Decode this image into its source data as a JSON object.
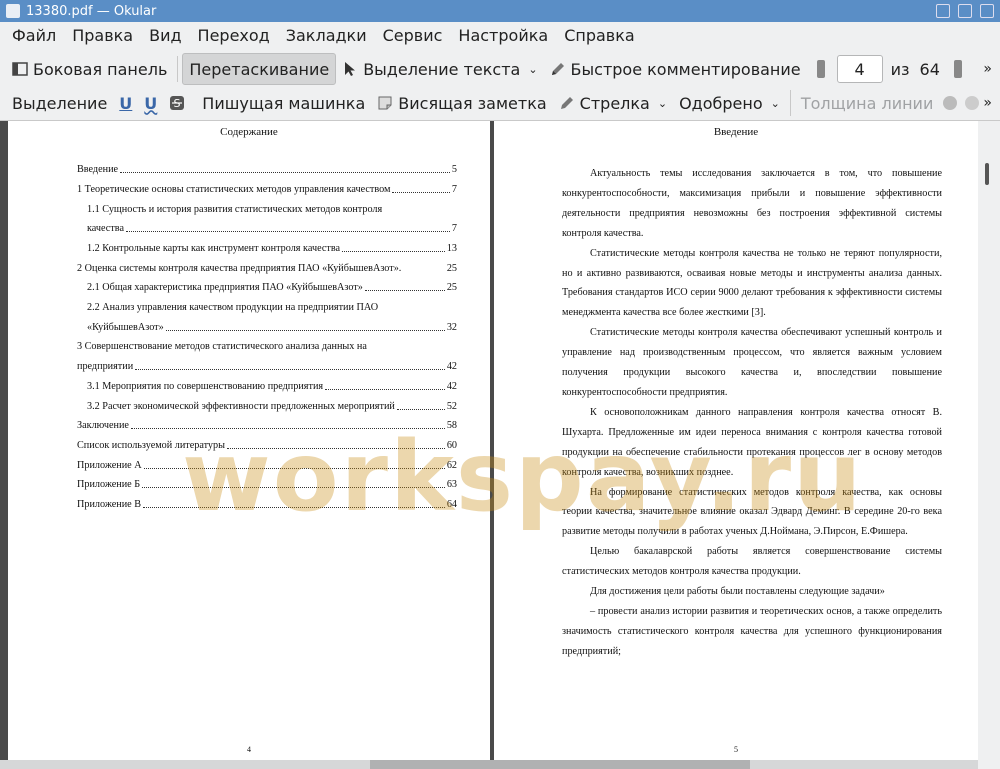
{
  "window": {
    "title": "13380.pdf  — Okular"
  },
  "menu": [
    "Файл",
    "Правка",
    "Вид",
    "Переход",
    "Закладки",
    "Сервис",
    "Настройка",
    "Справка"
  ],
  "toolbar1": {
    "sidebar": "Боковая панель",
    "drag": "Перетаскивание",
    "text_select": "Выделение текста",
    "quick_comment": "Быстрое комментирование",
    "page_current": "4",
    "page_of": "из",
    "page_total": "64"
  },
  "toolbar2": {
    "highlight": "Выделение",
    "typewriter": "Пишущая машинка",
    "sticky": "Висящая заметка",
    "arrow": "Стрелка",
    "approved": "Одобрено",
    "line_width": "Толщина линии"
  },
  "left_page": {
    "title": "Содержание",
    "number": "4",
    "toc": [
      {
        "text": "Введение",
        "page": "5"
      },
      {
        "text": "1 Теоретические основы статистических методов управления качеством",
        "page": "7"
      },
      {
        "text": "1.1 Сущность и история развития статистических методов контроля",
        "page": ""
      },
      {
        "text": "качества",
        "page": "7"
      },
      {
        "text": "1.2 Контрольные карты как инструмент контроля качества",
        "page": "13"
      },
      {
        "text": "2 Оценка системы контроля качества предприятия ПАО «КуйбышевАзот».",
        "page": "25"
      },
      {
        "text": "2.1 Общая характеристика предприятия ПАО «КуйбышевАзот»",
        "page": "25"
      },
      {
        "text": "2.2 Анализ управления качеством продукции на предприятии ПАО",
        "page": ""
      },
      {
        "text": "«КуйбышевАзот»",
        "page": "32"
      },
      {
        "text": "3 Совершенствование методов статистического анализа данных на",
        "page": ""
      },
      {
        "text": "предприятии",
        "page": "42"
      },
      {
        "text": "3.1 Мероприятия по совершенствованию предприятия",
        "page": "42"
      },
      {
        "text": "3.2 Расчет экономической эффективности предложенных мероприятий",
        "page": "52"
      },
      {
        "text": "Заключение",
        "page": "58"
      },
      {
        "text": "Список используемой литературы",
        "page": "60"
      },
      {
        "text": "Приложение А",
        "page": "62"
      },
      {
        "text": "Приложение Б",
        "page": "63"
      },
      {
        "text": "Приложение В",
        "page": "64"
      }
    ]
  },
  "right_page": {
    "title": "Введение",
    "number": "5",
    "paragraphs": [
      "Актуальность темы исследования заключается в том, что повышение конкурентоспособности, максимизация прибыли и повышение эффективности деятельности предприятия невозможны без построения эффективной системы контроля качества.",
      "Статистические методы контроля качества не только не теряют популярности, но и активно развиваются, осваивая новые методы и инструменты анализа данных. Требования стандартов ИСО серии 9000 делают требования к эффективности системы менеджмента качества все более жесткими [3].",
      "Статистические методы контроля качества обеспечивают успешный контроль и управление над производственным процессом, что является важным условием получения продукции высокого качества и, впоследствии повышение конкурентоспособности предприятия.",
      "К основоположникам данного направления контроля качества относят В. Шухарта. Предложенные им идеи переноса внимания с контроля качества готовой продукции на обеспечение стабильности протекания процессов лег в основу методов контроля качества, возникших позднее.",
      "На формирование статистических методов контроля качества, как основы теории качества, значительное влияние оказал Эдвард Деминг. В середине 20-го века развитие методы получили в работах ученых Д.Ноймана, Э.Пирсон, Е.Фишера.",
      "Целью бакалаврской работы является совершенствование системы статистических методов контроля качества продукции.",
      "Для достижения цели работы были поставлены следующие задачи»",
      "– провести анализ истории развития и теоретических основ, а также определить значимость статистического контроля качества для успешного функционирования предприятий;"
    ]
  },
  "watermark": "workspay.ru"
}
